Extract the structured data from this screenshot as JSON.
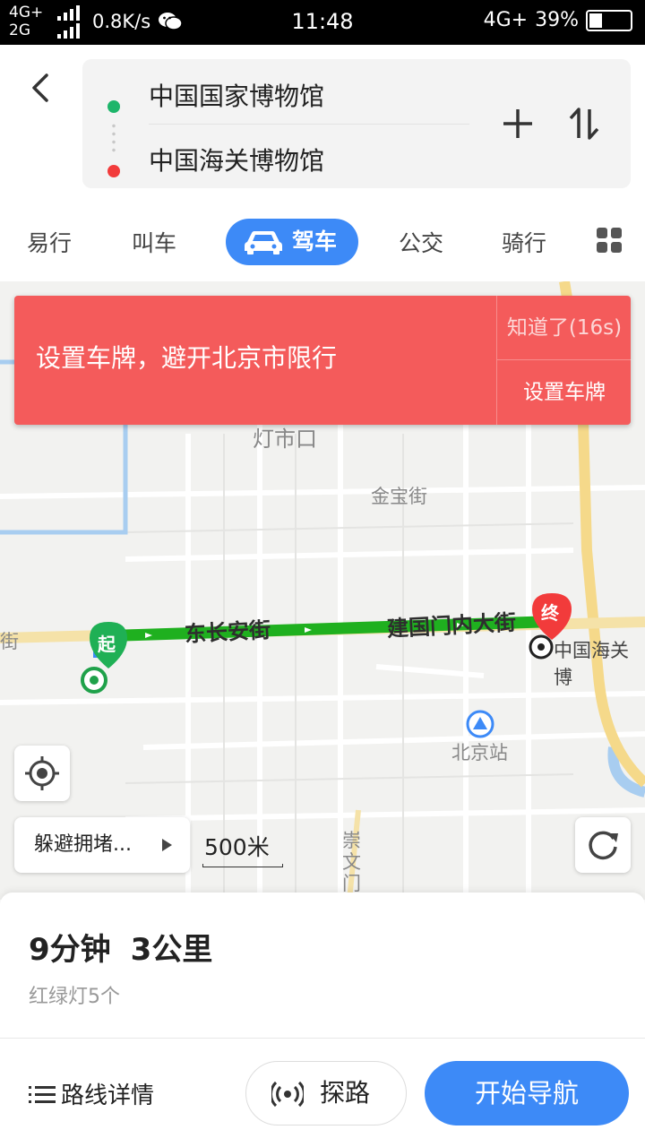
{
  "status_bar": {
    "net_top": "4G+",
    "net_bottom": "2G",
    "speed": "0.8K/s",
    "time": "11:48",
    "net_right": "4G+",
    "battery": "39%"
  },
  "route": {
    "origin": "中国国家博物馆",
    "destination": "中国海关博物馆"
  },
  "tabs": [
    {
      "label": "易行"
    },
    {
      "label": "叫车"
    },
    {
      "label": "驾车",
      "active": true
    },
    {
      "label": "公交"
    },
    {
      "label": "骑行"
    }
  ],
  "alert": {
    "message": "设置车牌，避开北京市限行",
    "dismiss": "知道了(16s)",
    "action": "设置车牌",
    "color": "#f45b5b"
  },
  "map": {
    "labels": {
      "dengshikou": "灯市口",
      "jinbaojie": "金宝街",
      "beijingzhan": "北京站",
      "chongwenmen": "崇文门",
      "dest_poi": "中国海关博",
      "left_street": "街"
    },
    "roads": {
      "dongchanganjie": "东长安街",
      "jianguomen": "建国门内大街"
    },
    "start_marker": "起",
    "end_marker": "终",
    "avoid_label": "躲避拥堵...",
    "scale": "500米",
    "route_color": "#1fb01f"
  },
  "summary": {
    "duration": "9分钟",
    "distance": "3公里",
    "traffic_lights": "红绿灯5个"
  },
  "actions": {
    "details": "路线详情",
    "probe": "探路",
    "start": "开始导航"
  },
  "colors": {
    "accent": "#3d8af7"
  }
}
